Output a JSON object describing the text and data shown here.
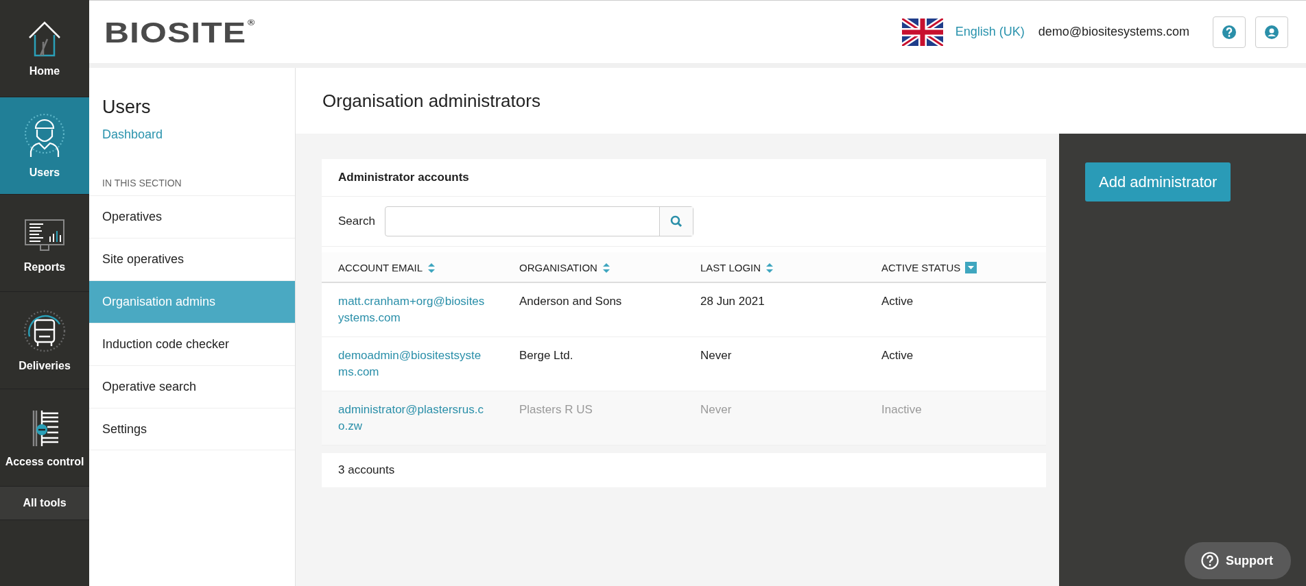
{
  "nav": {
    "items": [
      {
        "label": "Home",
        "kind": "home",
        "selected": false
      },
      {
        "label": "Users",
        "kind": "users",
        "selected": true
      },
      {
        "label": "Reports",
        "kind": "reports",
        "selected": false
      },
      {
        "label": "Deliveries",
        "kind": "deliveries",
        "selected": false
      },
      {
        "label": "Access control",
        "kind": "access",
        "selected": false
      }
    ],
    "all_tools": "All tools"
  },
  "header": {
    "brand": "BIOSITE",
    "registered": "®",
    "language": "English (UK)",
    "email": "demo@biositesystems.com"
  },
  "section": {
    "title": "Users",
    "dashboard_link": "Dashboard",
    "heading": "IN THIS SECTION",
    "items": [
      {
        "label": "Operatives",
        "selected": false
      },
      {
        "label": "Site operatives",
        "selected": false
      },
      {
        "label": "Organisation admins",
        "selected": true
      },
      {
        "label": "Induction code checker",
        "selected": false
      },
      {
        "label": "Operative search",
        "selected": false
      },
      {
        "label": "Settings",
        "selected": false
      }
    ]
  },
  "page": {
    "title": "Organisation administrators"
  },
  "card": {
    "title": "Administrator accounts",
    "search_label": "Search",
    "columns": [
      {
        "label": "ACCOUNT EMAIL",
        "kind": "sortable"
      },
      {
        "label": "ORGANISATION",
        "kind": "sortable"
      },
      {
        "label": "LAST LOGIN",
        "kind": "sortable"
      },
      {
        "label": "ACTIVE STATUS",
        "kind": "sorted"
      }
    ],
    "rows": [
      {
        "email": "matt.cranham+org@biositesystems.com",
        "organisation": "Anderson and Sons",
        "last_login": "28 Jun 2021",
        "status": "Active",
        "inactive": false
      },
      {
        "email": "demoadmin@biositestsystems.com",
        "organisation": "Berge Ltd.",
        "last_login": "Never",
        "status": "Active",
        "inactive": false
      },
      {
        "email": "administrator@plastersrus.co.zw",
        "organisation": "Plasters R US",
        "last_login": "Never",
        "status": "Inactive",
        "inactive": true
      }
    ]
  },
  "footer": {
    "count": "3 accounts"
  },
  "actions": {
    "add_button": "Add administrator"
  },
  "support": {
    "label": "Support"
  }
}
